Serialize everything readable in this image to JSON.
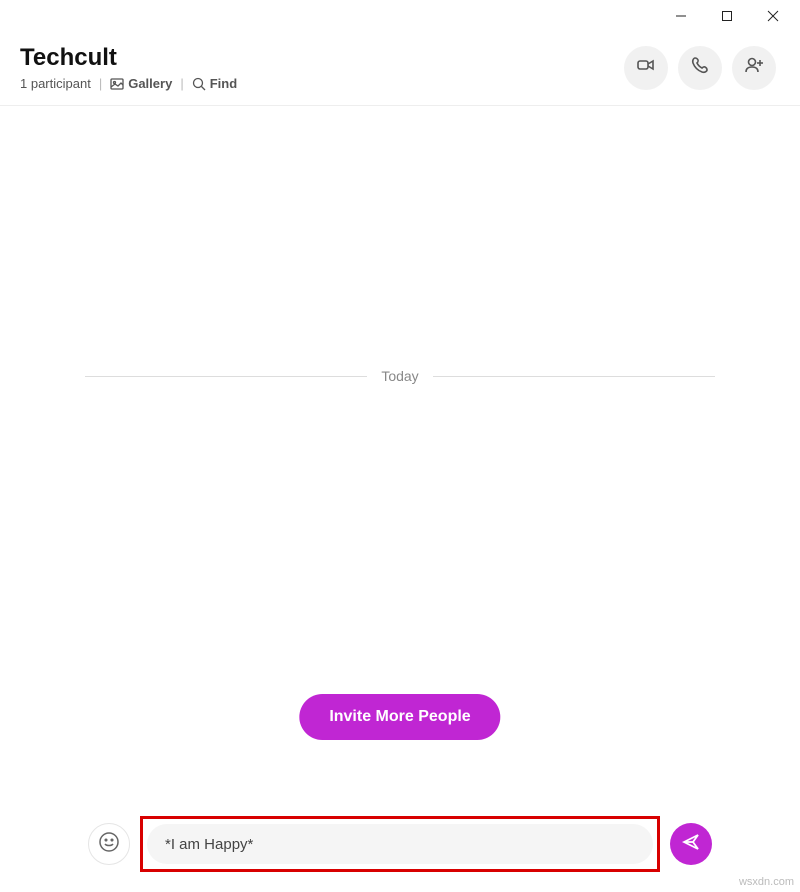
{
  "chat": {
    "title": "Techcult",
    "participants_label": "1 participant",
    "gallery_label": "Gallery",
    "find_label": "Find"
  },
  "divider": {
    "label": "Today"
  },
  "invite": {
    "label": "Invite More People"
  },
  "composer": {
    "value": "*I am Happy*"
  },
  "watermark": "wsxdn.com"
}
